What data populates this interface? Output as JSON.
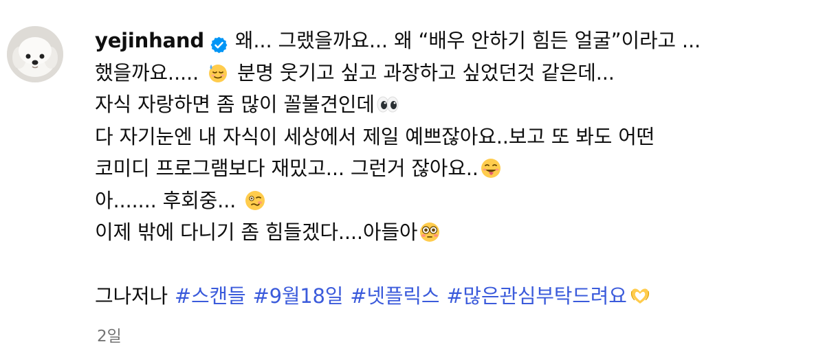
{
  "comment": {
    "username": "yejinhand",
    "lines": [
      "왜... 그랬을까요... 왜 “배우 안하기 힘든 얼굴”이라고 ...",
      "했을까요.....",
      "분명 웃기고 싶고 과장하고 싶었던것 같은데...",
      "자식 자랑하면 좀 많이 꼴불견인데",
      "다 자기눈엔 내 자식이 세상에서 제일 예쁘잖아요..보고 또 봐도 어떤",
      "코미디 프로그램보다 재밌고... 그런거 잖아요..",
      "아....... 후회중...",
      "이제 밖에 다니기 좀 힘들겠다....아들아"
    ],
    "prefix": "그나저나",
    "hashtags": [
      "#스캔들",
      "#9월18일",
      "#넷플릭스",
      "#많은관심부탁드려요"
    ],
    "timestamp": "2일"
  },
  "icons": {
    "verified": "verified-badge-icon",
    "emoji_1": "sweat-smile-emoji",
    "emoji_2": "eyes-emoji",
    "emoji_3": "tongue-out-emoji",
    "emoji_4": "woozy-face-emoji",
    "emoji_5": "flushed-face-emoji",
    "emoji_6": "heart-hands-emoji"
  },
  "colors": {
    "hashtag": "#3b5bdb",
    "verified": "#0095f6",
    "timestamp": "#737373"
  }
}
